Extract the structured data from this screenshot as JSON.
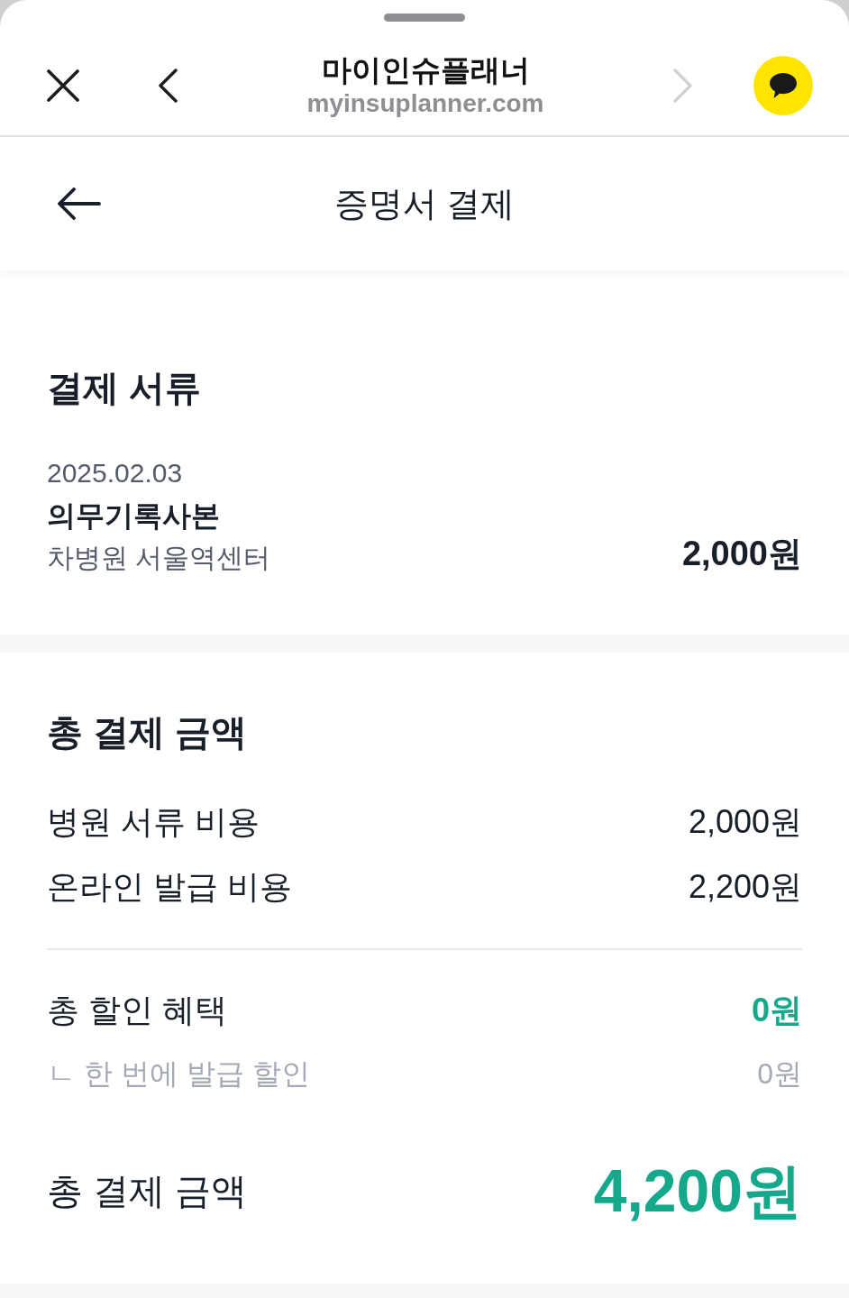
{
  "browser_bar": {
    "title": "마이인슈플래너",
    "url": "myinsuplanner.com",
    "back_button": {
      "disabled": false
    },
    "forward_button": {
      "disabled": true
    }
  },
  "page_header": {
    "title": "증명서 결제"
  },
  "documents": {
    "title": "결제 서류",
    "items": [
      {
        "date": "2025.02.03",
        "name": "의무기록사본",
        "hospital": "차병원 서울역센터",
        "price": "2,000원"
      }
    ]
  },
  "summary": {
    "title": "총 결제 금액",
    "costs": [
      {
        "label": "병원 서류 비용",
        "amount": "2,000원"
      },
      {
        "label": "온라인 발급 비용",
        "amount": "2,200원"
      }
    ],
    "discount": {
      "label": "총 할인 혜택",
      "amount": "0원",
      "details": [
        {
          "label": "ㄴ 한 번에 발급 할인",
          "amount": "0원"
        }
      ]
    },
    "total": {
      "label": "총 결제 금액",
      "amount": "4,200원"
    }
  }
}
